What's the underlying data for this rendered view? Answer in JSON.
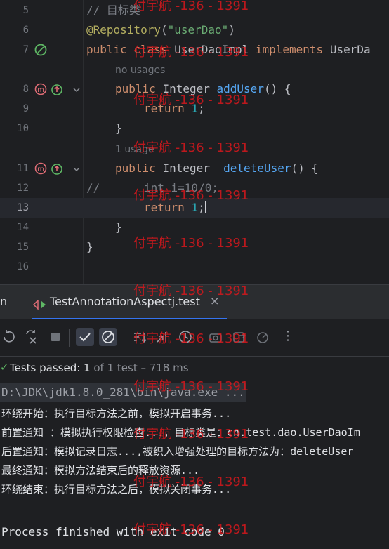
{
  "editor": {
    "lines": [
      {
        "no": "5",
        "comment": "// 目标类"
      },
      {
        "no": "6",
        "annotation": "@Repository",
        "open": "(",
        "string": "\"userDao\"",
        "close": ")"
      },
      {
        "no": "7",
        "kw1": "public",
        "kw2": "class",
        "classname": "UserDaoImpl",
        "kw3": "implements",
        "iface": "UserDa"
      },
      {
        "no": "8",
        "kw": "public",
        "type": "Integer",
        "method": "addUser",
        "rest": "() {"
      },
      {
        "no": "9",
        "kw": "return",
        "num": "1",
        "semi": ";"
      },
      {
        "no": "10",
        "text": "}"
      },
      {
        "no": "11",
        "kw": "public",
        "type": "Integer",
        "method": "deleteUser",
        "rest": "() {"
      },
      {
        "no": "12",
        "comment_prefix": "//",
        "code": "int i=10/0;"
      },
      {
        "no": "13",
        "kw": "return",
        "num": "1",
        "semi": ";"
      },
      {
        "no": "14",
        "text": "}"
      },
      {
        "no": "15",
        "text": "}"
      },
      {
        "no": "16"
      }
    ],
    "hints": {
      "no_usages": "no usages",
      "one_usage": "1 usage"
    }
  },
  "run_panel": {
    "tab_cut_label": "n",
    "tab_label": "TestAnnotationAspectj.test",
    "tab_close": "×",
    "more": "⋮",
    "status": {
      "check": "✓",
      "passed": "Tests passed:",
      "count": " 1",
      "detail": " of 1 test – 718 ms"
    },
    "console": {
      "command": "D:\\JDK\\jdk1.8.0_281\\bin\\java.exe ...",
      "lines": [
        "环绕开始：执行目标方法之前，模拟开启事务...",
        "前置通知 ：模拟执行权限检查...，目标类是：cn.test.dao.UserDaoIm",
        "后置通知：模拟记录日志...,被织入增强处理的目标方法为：deleteUser",
        "最终通知：模拟方法结束后的释放资源...",
        "环绕结束：执行目标方法之后，模拟关闭事务..."
      ],
      "finished": "Process finished with exit code 0"
    }
  },
  "watermark": "付宇航 -136 - 1391",
  "colors": {
    "background": "#1e1f22",
    "keyword": "#cf8e6d",
    "annotation": "#b3ae60",
    "string": "#6aab73",
    "method": "#56a8f5",
    "number": "#2aacb8",
    "watermark": "#e0171c",
    "passed": "#5fb865"
  }
}
